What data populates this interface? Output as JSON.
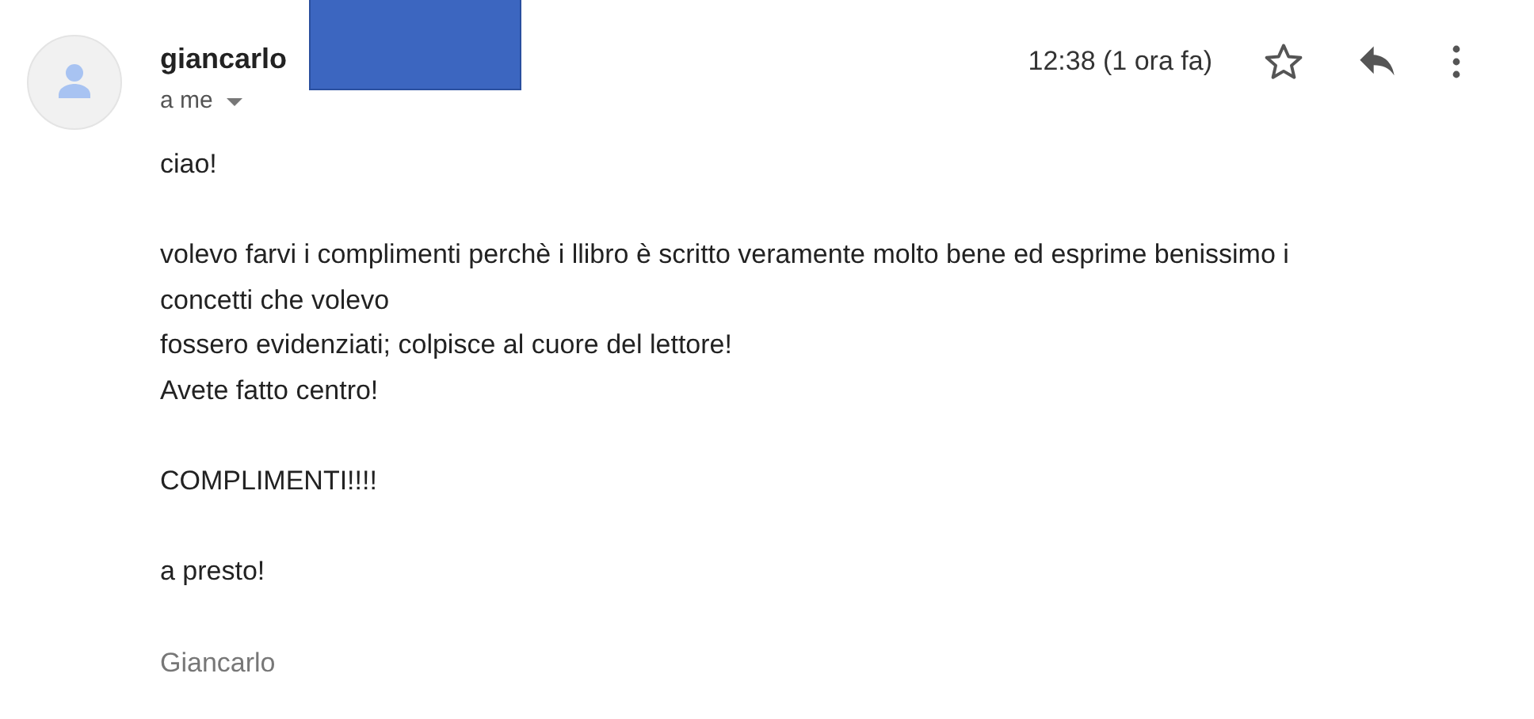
{
  "message": {
    "sender": "giancarlo",
    "recipient": "a me",
    "redacted": true,
    "time": "12:38 (1 ora fa)",
    "starred": false
  },
  "body": [
    {
      "kind": "text",
      "lines": [
        "ciao!"
      ]
    },
    {
      "kind": "text",
      "lines": [
        "volevo farvi i complimenti perchè i llibro è scritto veramente molto bene ed esprime benissimo i",
        "concetti che volevo",
        "fossero evidenziati; colpisce al cuore del lettore!",
        "Avete fatto centro!"
      ]
    },
    {
      "kind": "text",
      "lines": [
        "COMPLIMENTI!!!!"
      ]
    },
    {
      "kind": "text",
      "lines": [
        "a presto!"
      ]
    },
    {
      "kind": "signature",
      "lines": [
        "Giancarlo"
      ]
    }
  ]
}
